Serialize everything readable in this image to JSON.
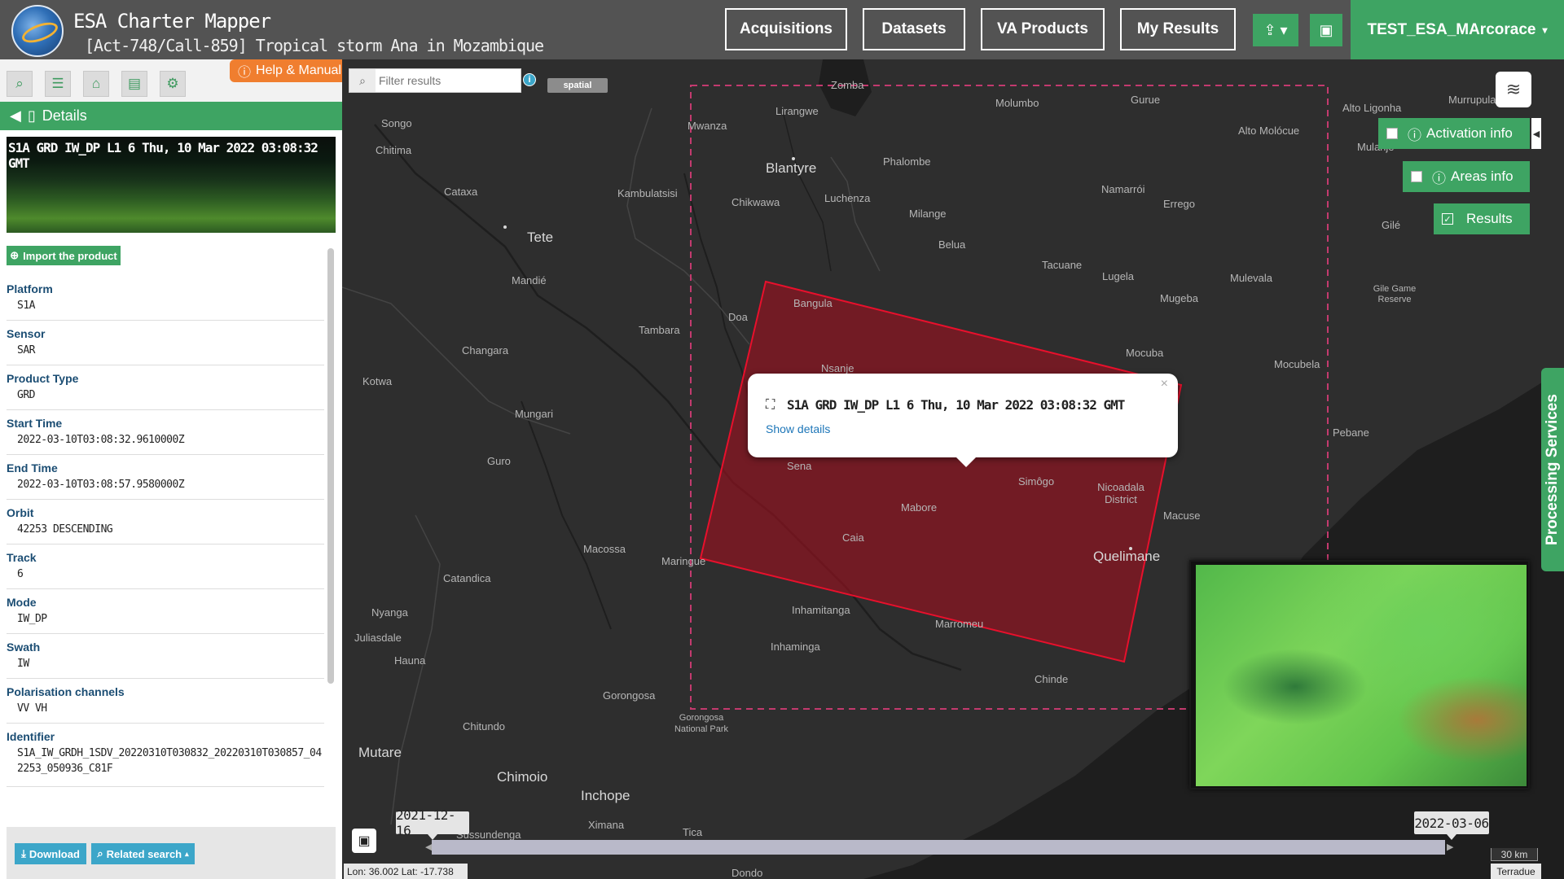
{
  "header": {
    "app_title": "ESA Charter Mapper",
    "activation_title": "[Act-748/Call-859] Tropical storm Ana in Mozambique",
    "nav": [
      "Acquisitions",
      "Datasets",
      "VA Products",
      "My Results"
    ],
    "upload_icon": "upload-icon",
    "briefcase_icon": "briefcase-icon",
    "user": "TEST_ESA_MArcorace"
  },
  "sidebar": {
    "tools": [
      "search-icon",
      "list-icon",
      "basket-icon",
      "archive-icon",
      "gear-icon"
    ],
    "help_label": "Help & Manual",
    "details_label": "Details",
    "product_title": "S1A GRD IW_DP L1 6 Thu, 10 Mar 2022 03:08:32 GMT",
    "import_label": "Import the product",
    "fields": [
      {
        "label": "Platform",
        "value": "S1A"
      },
      {
        "label": "Sensor",
        "value": "SAR"
      },
      {
        "label": "Product Type",
        "value": "GRD"
      },
      {
        "label": "Start Time",
        "value": "2022-03-10T03:08:32.9610000Z"
      },
      {
        "label": "End Time",
        "value": "2022-03-10T03:08:57.9580000Z"
      },
      {
        "label": "Orbit",
        "value": "42253 DESCENDING"
      },
      {
        "label": "Track",
        "value": "6"
      },
      {
        "label": "Mode",
        "value": "IW_DP"
      },
      {
        "label": "Swath",
        "value": "IW"
      },
      {
        "label": "Polarisation channels",
        "value": "VV VH"
      },
      {
        "label": "Identifier",
        "value": "S1A_IW_GRDH_1SDV_20220310T030832_20220310T030857_042253_050936_C81F"
      }
    ],
    "download_label": "Download",
    "related_label": "Related search"
  },
  "map": {
    "filter_placeholder": "Filter results",
    "spatial_badge": "spatial",
    "activation_info": "Activation info",
    "areas_info": "Areas info",
    "results": "Results",
    "processing_services": "Processing Services",
    "popup": {
      "title": "S1A GRD IW_DP L1 6 Thu, 10 Mar 2022 03:08:32 GMT",
      "link": "Show details"
    },
    "timeline": {
      "start": "2021-12-16",
      "end": "2022-03-06"
    },
    "coordinates": "Lon: 36.002 Lat: -17.738",
    "scale": "30 km",
    "attribution": "Terradue",
    "places": [
      {
        "name": "Zomba",
        "cls": ""
      },
      {
        "name": "Lirangwe",
        "cls": ""
      },
      {
        "name": "Molumbo",
        "cls": ""
      },
      {
        "name": "Gurue",
        "cls": ""
      },
      {
        "name": "Alto Ligonha",
        "cls": ""
      },
      {
        "name": "Murrupula",
        "cls": ""
      },
      {
        "name": "Songo",
        "cls": ""
      },
      {
        "name": "Mwanza",
        "cls": ""
      },
      {
        "name": "Alto Molócue",
        "cls": ""
      },
      {
        "name": "Chitima",
        "cls": ""
      },
      {
        "name": "Blantyre",
        "cls": "big"
      },
      {
        "name": "Phalombe",
        "cls": ""
      },
      {
        "name": "Mulanje",
        "cls": ""
      },
      {
        "name": "Cataxa",
        "cls": ""
      },
      {
        "name": "Kambulatsisi",
        "cls": ""
      },
      {
        "name": "Namarrói",
        "cls": ""
      },
      {
        "name": "Chikwawa",
        "cls": ""
      },
      {
        "name": "Luchenza",
        "cls": ""
      },
      {
        "name": "Errego",
        "cls": ""
      },
      {
        "name": "Milange",
        "cls": ""
      },
      {
        "name": "Tete",
        "cls": "big"
      },
      {
        "name": "Gilé",
        "cls": ""
      },
      {
        "name": "Belua",
        "cls": ""
      },
      {
        "name": "Tacuane",
        "cls": ""
      },
      {
        "name": "Lugela",
        "cls": ""
      },
      {
        "name": "Mandié",
        "cls": ""
      },
      {
        "name": "Mulevala",
        "cls": ""
      },
      {
        "name": "Gile Game Reserve",
        "cls": ""
      },
      {
        "name": "Mugeba",
        "cls": ""
      },
      {
        "name": "Bangula",
        "cls": ""
      },
      {
        "name": "Doa",
        "cls": ""
      },
      {
        "name": "Tambara",
        "cls": ""
      },
      {
        "name": "Changara",
        "cls": ""
      },
      {
        "name": "Mocuba",
        "cls": ""
      },
      {
        "name": "Mocubela",
        "cls": ""
      },
      {
        "name": "Nsanje",
        "cls": ""
      },
      {
        "name": "Kotwa",
        "cls": ""
      },
      {
        "name": "Mungari",
        "cls": ""
      },
      {
        "name": "Pebane",
        "cls": ""
      },
      {
        "name": "Guro",
        "cls": ""
      },
      {
        "name": "Sena",
        "cls": ""
      },
      {
        "name": "Simôgo",
        "cls": ""
      },
      {
        "name": "Nicoadala District",
        "cls": ""
      },
      {
        "name": "Mabore",
        "cls": ""
      },
      {
        "name": "Macuse",
        "cls": ""
      },
      {
        "name": "Caia",
        "cls": ""
      },
      {
        "name": "Macossa",
        "cls": ""
      },
      {
        "name": "Maringue",
        "cls": ""
      },
      {
        "name": "Quelimane",
        "cls": "big"
      },
      {
        "name": "Catandica",
        "cls": ""
      },
      {
        "name": "Inhamitanga",
        "cls": ""
      },
      {
        "name": "Nyanga",
        "cls": ""
      },
      {
        "name": "Marromeu",
        "cls": ""
      },
      {
        "name": "Juliasdale",
        "cls": ""
      },
      {
        "name": "Inhaminga",
        "cls": ""
      },
      {
        "name": "Hauna",
        "cls": ""
      },
      {
        "name": "Chinde",
        "cls": ""
      },
      {
        "name": "Gorongosa",
        "cls": ""
      },
      {
        "name": "Gorongosa National Park",
        "cls": ""
      },
      {
        "name": "Chitundo",
        "cls": ""
      },
      {
        "name": "Mutare",
        "cls": "big"
      },
      {
        "name": "Chimoio",
        "cls": "big"
      },
      {
        "name": "Inchope",
        "cls": "big"
      },
      {
        "name": "Ximana",
        "cls": ""
      },
      {
        "name": "Sussundenga",
        "cls": ""
      },
      {
        "name": "Tica",
        "cls": ""
      },
      {
        "name": "Dondo",
        "cls": ""
      }
    ]
  },
  "colors": {
    "accent_green": "#3ea463",
    "header_gray": "#535353",
    "help_orange": "#f07e2f",
    "footprint_red": "#d0142c"
  }
}
